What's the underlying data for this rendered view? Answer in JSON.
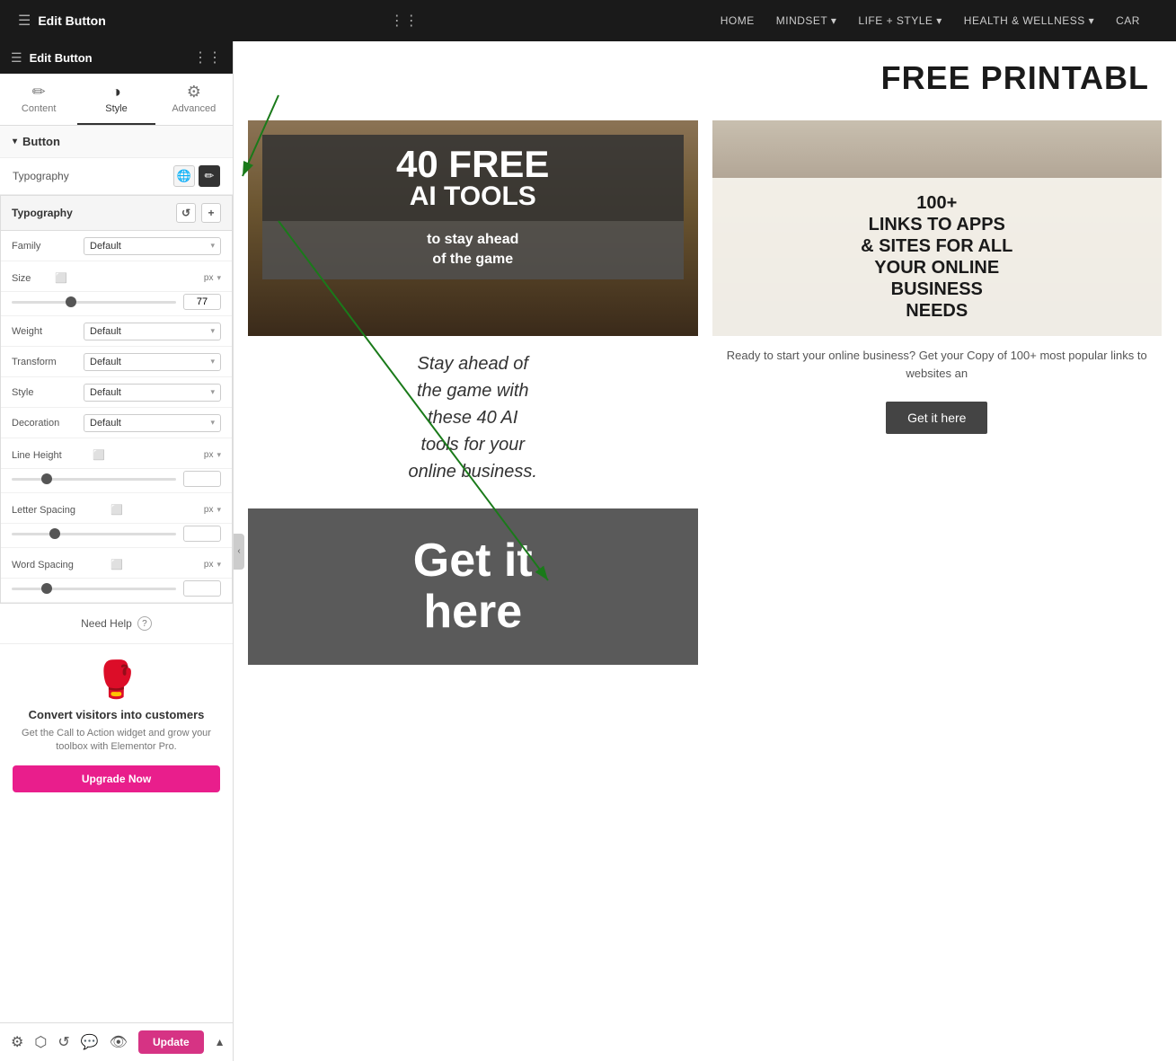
{
  "topNav": {
    "title": "Edit Button",
    "gridIcon": "⋮⋮",
    "hamburgerIcon": "☰",
    "navLinks": [
      {
        "label": "HOME",
        "hasArrow": false
      },
      {
        "label": "MINDSET",
        "hasArrow": true
      },
      {
        "label": "LIFE + STYLE",
        "hasArrow": true
      },
      {
        "label": "HEALTH & WELLNESS",
        "hasArrow": true
      },
      {
        "label": "CAR",
        "hasArrow": false
      }
    ]
  },
  "sidebar": {
    "tabs": [
      {
        "label": "Content",
        "icon": "✏"
      },
      {
        "label": "Style",
        "icon": "◑"
      },
      {
        "label": "Advanced",
        "icon": "⚙"
      }
    ],
    "activeTab": "Style",
    "sectionTitle": "Button",
    "typographyLabel": "Typography",
    "typographyPanel": {
      "title": "Typography",
      "resetIcon": "↺",
      "addIcon": "+",
      "family": {
        "label": "Family",
        "value": "Default"
      },
      "size": {
        "label": "Size",
        "unit": "px",
        "value": "77",
        "sliderPercent": 35
      },
      "weight": {
        "label": "Weight",
        "value": "Default"
      },
      "transform": {
        "label": "Transform",
        "value": "Default"
      },
      "style": {
        "label": "Style",
        "value": "Default"
      },
      "decoration": {
        "label": "Decoration",
        "value": "Default"
      },
      "lineHeight": {
        "label": "Line Height",
        "unit": "px",
        "sliderPercent": 20
      },
      "letterSpacing": {
        "label": "Letter Spacing",
        "unit": "px",
        "sliderPercent": 25
      },
      "wordSpacing": {
        "label": "Word Spacing",
        "unit": "px",
        "sliderPercent": 20
      }
    },
    "needHelp": "Need Help",
    "promo": {
      "title": "Convert visitors into customers",
      "desc": "Get the Call to Action widget and grow your toolbox with Elementor Pro.",
      "upgradeLabel": "Upgrade Now"
    }
  },
  "bottomBar": {
    "updateLabel": "Update"
  },
  "website": {
    "heroTitle": "FREE PRINTABL",
    "card1": {
      "overlayNumber": "40 FREE",
      "overlaySubtitle": "AI TOOLS",
      "overlayDesc": "to stay ahead\nof the game",
      "bodyText": "Stay ahead of the game with these 40 AI tools for your online business."
    },
    "card2": {
      "title": "100+\nLINKS TO APPS\n& SITES FOR ALL\nYOUR ONLINE\nBUSINESS\nNEEDS",
      "bodyText": "Ready to start your online business? Get your Copy of 100+ most popular links to websites an",
      "buttonLabel": "Get it here"
    },
    "cta": {
      "text": "Get it\nhere"
    }
  }
}
